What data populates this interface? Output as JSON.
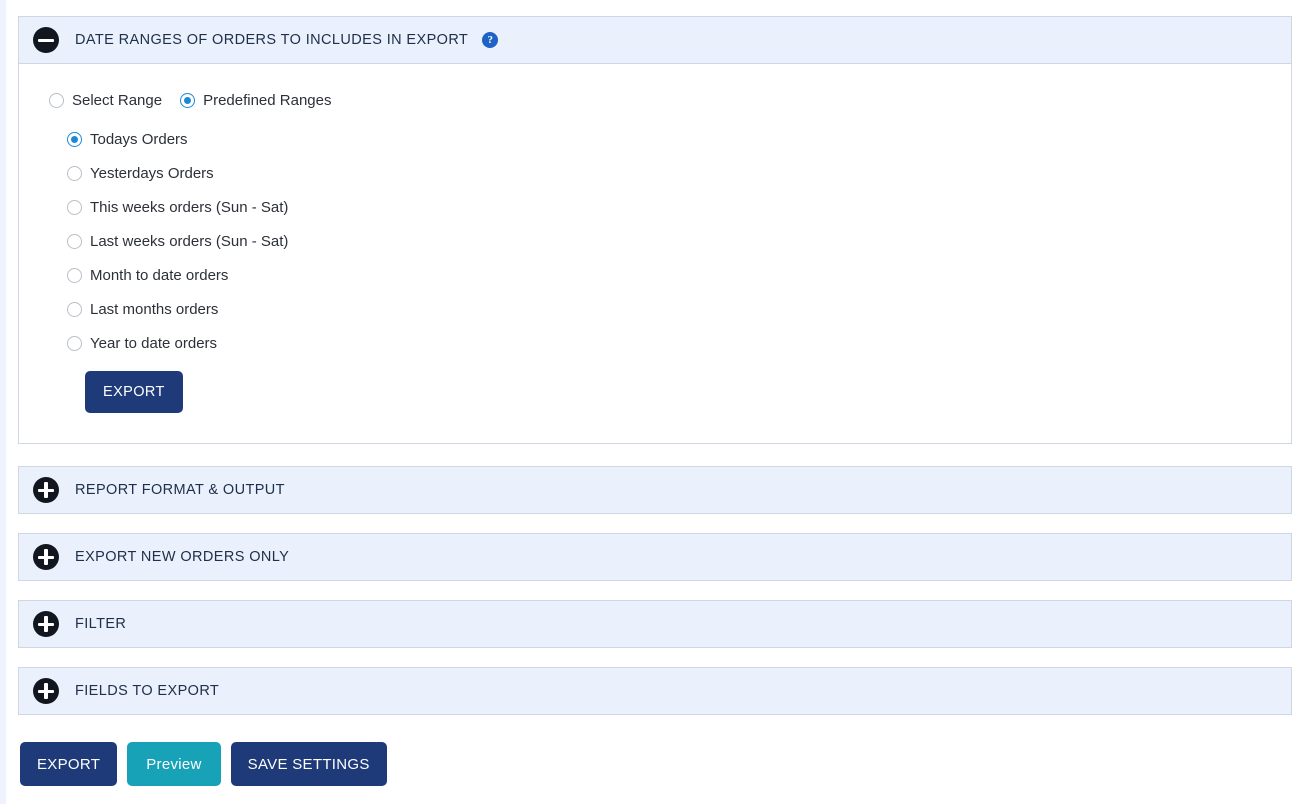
{
  "sections": [
    {
      "id": "date-ranges",
      "title": "DATE RANGES OF ORDERS TO INCLUDES IN EXPORT",
      "expanded": true,
      "toggle_icon": "minus-circle-icon",
      "help_icon": "help-circle-icon",
      "help_glyph": "?"
    },
    {
      "id": "report-format",
      "title": "REPORT FORMAT & OUTPUT",
      "expanded": false,
      "toggle_icon": "plus-circle-icon"
    },
    {
      "id": "export-new-orders",
      "title": "EXPORT NEW ORDERS ONLY",
      "expanded": false,
      "toggle_icon": "plus-circle-icon"
    },
    {
      "id": "filter",
      "title": "FILTER",
      "expanded": false,
      "toggle_icon": "plus-circle-icon"
    },
    {
      "id": "fields-to-export",
      "title": "FIELDS TO EXPORT",
      "expanded": false,
      "toggle_icon": "plus-circle-icon"
    }
  ],
  "date_ranges": {
    "mode_options": [
      {
        "label": "Select Range",
        "checked": false
      },
      {
        "label": "Predefined Ranges",
        "checked": true
      }
    ],
    "predefined_ranges": [
      {
        "label": "Todays Orders",
        "checked": true
      },
      {
        "label": "Yesterdays Orders",
        "checked": false
      },
      {
        "label": "This weeks orders (Sun - Sat)",
        "checked": false
      },
      {
        "label": "Last weeks orders (Sun - Sat)",
        "checked": false
      },
      {
        "label": "Month to date orders",
        "checked": false
      },
      {
        "label": "Last months orders",
        "checked": false
      },
      {
        "label": "Year to date orders",
        "checked": false
      }
    ],
    "export_button": "EXPORT"
  },
  "footer": {
    "export_label": "EXPORT",
    "preview_label": "Preview",
    "save_settings_label": "SAVE SETTINGS"
  },
  "colors": {
    "navy": "#1e3a78",
    "teal": "#17a2b8",
    "header_bg": "#eaf1fd",
    "radio_accent": "#1e88d2",
    "help_blue": "#1d62c4"
  }
}
